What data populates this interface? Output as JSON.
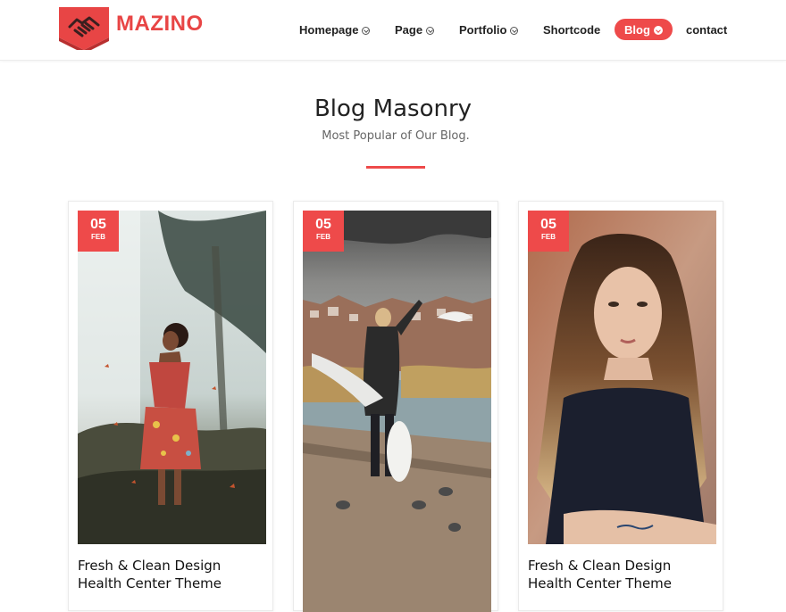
{
  "brand": {
    "name": "MAZINO",
    "accent": "#ee4a4a"
  },
  "nav": {
    "items": [
      {
        "label": "Homepage",
        "has_dropdown": true,
        "active": false
      },
      {
        "label": "Page",
        "has_dropdown": true,
        "active": false
      },
      {
        "label": "Portfolio",
        "has_dropdown": true,
        "active": false
      },
      {
        "label": "Shortcode",
        "has_dropdown": false,
        "active": false
      },
      {
        "label": "Blog",
        "has_dropdown": true,
        "active": true
      },
      {
        "label": "contact",
        "has_dropdown": false,
        "active": false
      }
    ]
  },
  "section": {
    "title": "Blog Masonry",
    "subtitle": "Most Popular of Our Blog."
  },
  "posts": [
    {
      "day": "05",
      "month": "FEB",
      "title": "Fresh & Clean Design Health Center Theme",
      "image": "woman-butterflies-forest-photo"
    },
    {
      "day": "05",
      "month": "FEB",
      "title": "",
      "image": "woman-feeding-birds-lakeside-photo"
    },
    {
      "day": "05",
      "month": "FEB",
      "title": "Fresh & Clean Design Health Center Theme",
      "image": "portrait-woman-long-hair-photo"
    }
  ]
}
